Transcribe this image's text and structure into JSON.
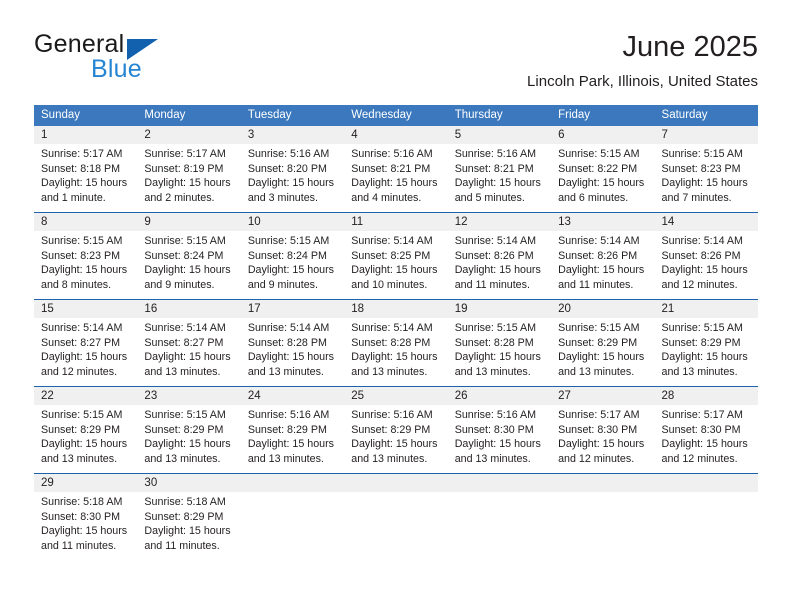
{
  "brand": {
    "name_top": "General",
    "name_bottom": "Blue",
    "triangle_icon": "triangle-icon",
    "color_top": "#1a1a1a",
    "color_bottom": "#2585d3",
    "color_triangle": "#1161ae"
  },
  "header": {
    "title": "June 2025",
    "subtitle": "Lincoln Park, Illinois, United States"
  },
  "theme": {
    "header_blue": "#3b78bd",
    "rule_blue": "#1c63ab",
    "daynum_band": "#f0f0f0",
    "text": "#231f20"
  },
  "calendar": {
    "weekdays": [
      "Sunday",
      "Monday",
      "Tuesday",
      "Wednesday",
      "Thursday",
      "Friday",
      "Saturday"
    ],
    "weeks": [
      {
        "days": [
          {
            "num": "1",
            "lines": [
              "Sunrise: 5:17 AM",
              "Sunset: 8:18 PM",
              "Daylight: 15 hours",
              "and 1 minute."
            ]
          },
          {
            "num": "2",
            "lines": [
              "Sunrise: 5:17 AM",
              "Sunset: 8:19 PM",
              "Daylight: 15 hours",
              "and 2 minutes."
            ]
          },
          {
            "num": "3",
            "lines": [
              "Sunrise: 5:16 AM",
              "Sunset: 8:20 PM",
              "Daylight: 15 hours",
              "and 3 minutes."
            ]
          },
          {
            "num": "4",
            "lines": [
              "Sunrise: 5:16 AM",
              "Sunset: 8:21 PM",
              "Daylight: 15 hours",
              "and 4 minutes."
            ]
          },
          {
            "num": "5",
            "lines": [
              "Sunrise: 5:16 AM",
              "Sunset: 8:21 PM",
              "Daylight: 15 hours",
              "and 5 minutes."
            ]
          },
          {
            "num": "6",
            "lines": [
              "Sunrise: 5:15 AM",
              "Sunset: 8:22 PM",
              "Daylight: 15 hours",
              "and 6 minutes."
            ]
          },
          {
            "num": "7",
            "lines": [
              "Sunrise: 5:15 AM",
              "Sunset: 8:23 PM",
              "Daylight: 15 hours",
              "and 7 minutes."
            ]
          }
        ]
      },
      {
        "days": [
          {
            "num": "8",
            "lines": [
              "Sunrise: 5:15 AM",
              "Sunset: 8:23 PM",
              "Daylight: 15 hours",
              "and 8 minutes."
            ]
          },
          {
            "num": "9",
            "lines": [
              "Sunrise: 5:15 AM",
              "Sunset: 8:24 PM",
              "Daylight: 15 hours",
              "and 9 minutes."
            ]
          },
          {
            "num": "10",
            "lines": [
              "Sunrise: 5:15 AM",
              "Sunset: 8:24 PM",
              "Daylight: 15 hours",
              "and 9 minutes."
            ]
          },
          {
            "num": "11",
            "lines": [
              "Sunrise: 5:14 AM",
              "Sunset: 8:25 PM",
              "Daylight: 15 hours",
              "and 10 minutes."
            ]
          },
          {
            "num": "12",
            "lines": [
              "Sunrise: 5:14 AM",
              "Sunset: 8:26 PM",
              "Daylight: 15 hours",
              "and 11 minutes."
            ]
          },
          {
            "num": "13",
            "lines": [
              "Sunrise: 5:14 AM",
              "Sunset: 8:26 PM",
              "Daylight: 15 hours",
              "and 11 minutes."
            ]
          },
          {
            "num": "14",
            "lines": [
              "Sunrise: 5:14 AM",
              "Sunset: 8:26 PM",
              "Daylight: 15 hours",
              "and 12 minutes."
            ]
          }
        ]
      },
      {
        "days": [
          {
            "num": "15",
            "lines": [
              "Sunrise: 5:14 AM",
              "Sunset: 8:27 PM",
              "Daylight: 15 hours",
              "and 12 minutes."
            ]
          },
          {
            "num": "16",
            "lines": [
              "Sunrise: 5:14 AM",
              "Sunset: 8:27 PM",
              "Daylight: 15 hours",
              "and 13 minutes."
            ]
          },
          {
            "num": "17",
            "lines": [
              "Sunrise: 5:14 AM",
              "Sunset: 8:28 PM",
              "Daylight: 15 hours",
              "and 13 minutes."
            ]
          },
          {
            "num": "18",
            "lines": [
              "Sunrise: 5:14 AM",
              "Sunset: 8:28 PM",
              "Daylight: 15 hours",
              "and 13 minutes."
            ]
          },
          {
            "num": "19",
            "lines": [
              "Sunrise: 5:15 AM",
              "Sunset: 8:28 PM",
              "Daylight: 15 hours",
              "and 13 minutes."
            ]
          },
          {
            "num": "20",
            "lines": [
              "Sunrise: 5:15 AM",
              "Sunset: 8:29 PM",
              "Daylight: 15 hours",
              "and 13 minutes."
            ]
          },
          {
            "num": "21",
            "lines": [
              "Sunrise: 5:15 AM",
              "Sunset: 8:29 PM",
              "Daylight: 15 hours",
              "and 13 minutes."
            ]
          }
        ]
      },
      {
        "days": [
          {
            "num": "22",
            "lines": [
              "Sunrise: 5:15 AM",
              "Sunset: 8:29 PM",
              "Daylight: 15 hours",
              "and 13 minutes."
            ]
          },
          {
            "num": "23",
            "lines": [
              "Sunrise: 5:15 AM",
              "Sunset: 8:29 PM",
              "Daylight: 15 hours",
              "and 13 minutes."
            ]
          },
          {
            "num": "24",
            "lines": [
              "Sunrise: 5:16 AM",
              "Sunset: 8:29 PM",
              "Daylight: 15 hours",
              "and 13 minutes."
            ]
          },
          {
            "num": "25",
            "lines": [
              "Sunrise: 5:16 AM",
              "Sunset: 8:29 PM",
              "Daylight: 15 hours",
              "and 13 minutes."
            ]
          },
          {
            "num": "26",
            "lines": [
              "Sunrise: 5:16 AM",
              "Sunset: 8:30 PM",
              "Daylight: 15 hours",
              "and 13 minutes."
            ]
          },
          {
            "num": "27",
            "lines": [
              "Sunrise: 5:17 AM",
              "Sunset: 8:30 PM",
              "Daylight: 15 hours",
              "and 12 minutes."
            ]
          },
          {
            "num": "28",
            "lines": [
              "Sunrise: 5:17 AM",
              "Sunset: 8:30 PM",
              "Daylight: 15 hours",
              "and 12 minutes."
            ]
          }
        ]
      },
      {
        "days": [
          {
            "num": "29",
            "lines": [
              "Sunrise: 5:18 AM",
              "Sunset: 8:30 PM",
              "Daylight: 15 hours",
              "and 11 minutes."
            ]
          },
          {
            "num": "30",
            "lines": [
              "Sunrise: 5:18 AM",
              "Sunset: 8:29 PM",
              "Daylight: 15 hours",
              "and 11 minutes."
            ]
          },
          {
            "num": "",
            "lines": []
          },
          {
            "num": "",
            "lines": []
          },
          {
            "num": "",
            "lines": []
          },
          {
            "num": "",
            "lines": []
          },
          {
            "num": "",
            "lines": []
          }
        ]
      }
    ]
  }
}
